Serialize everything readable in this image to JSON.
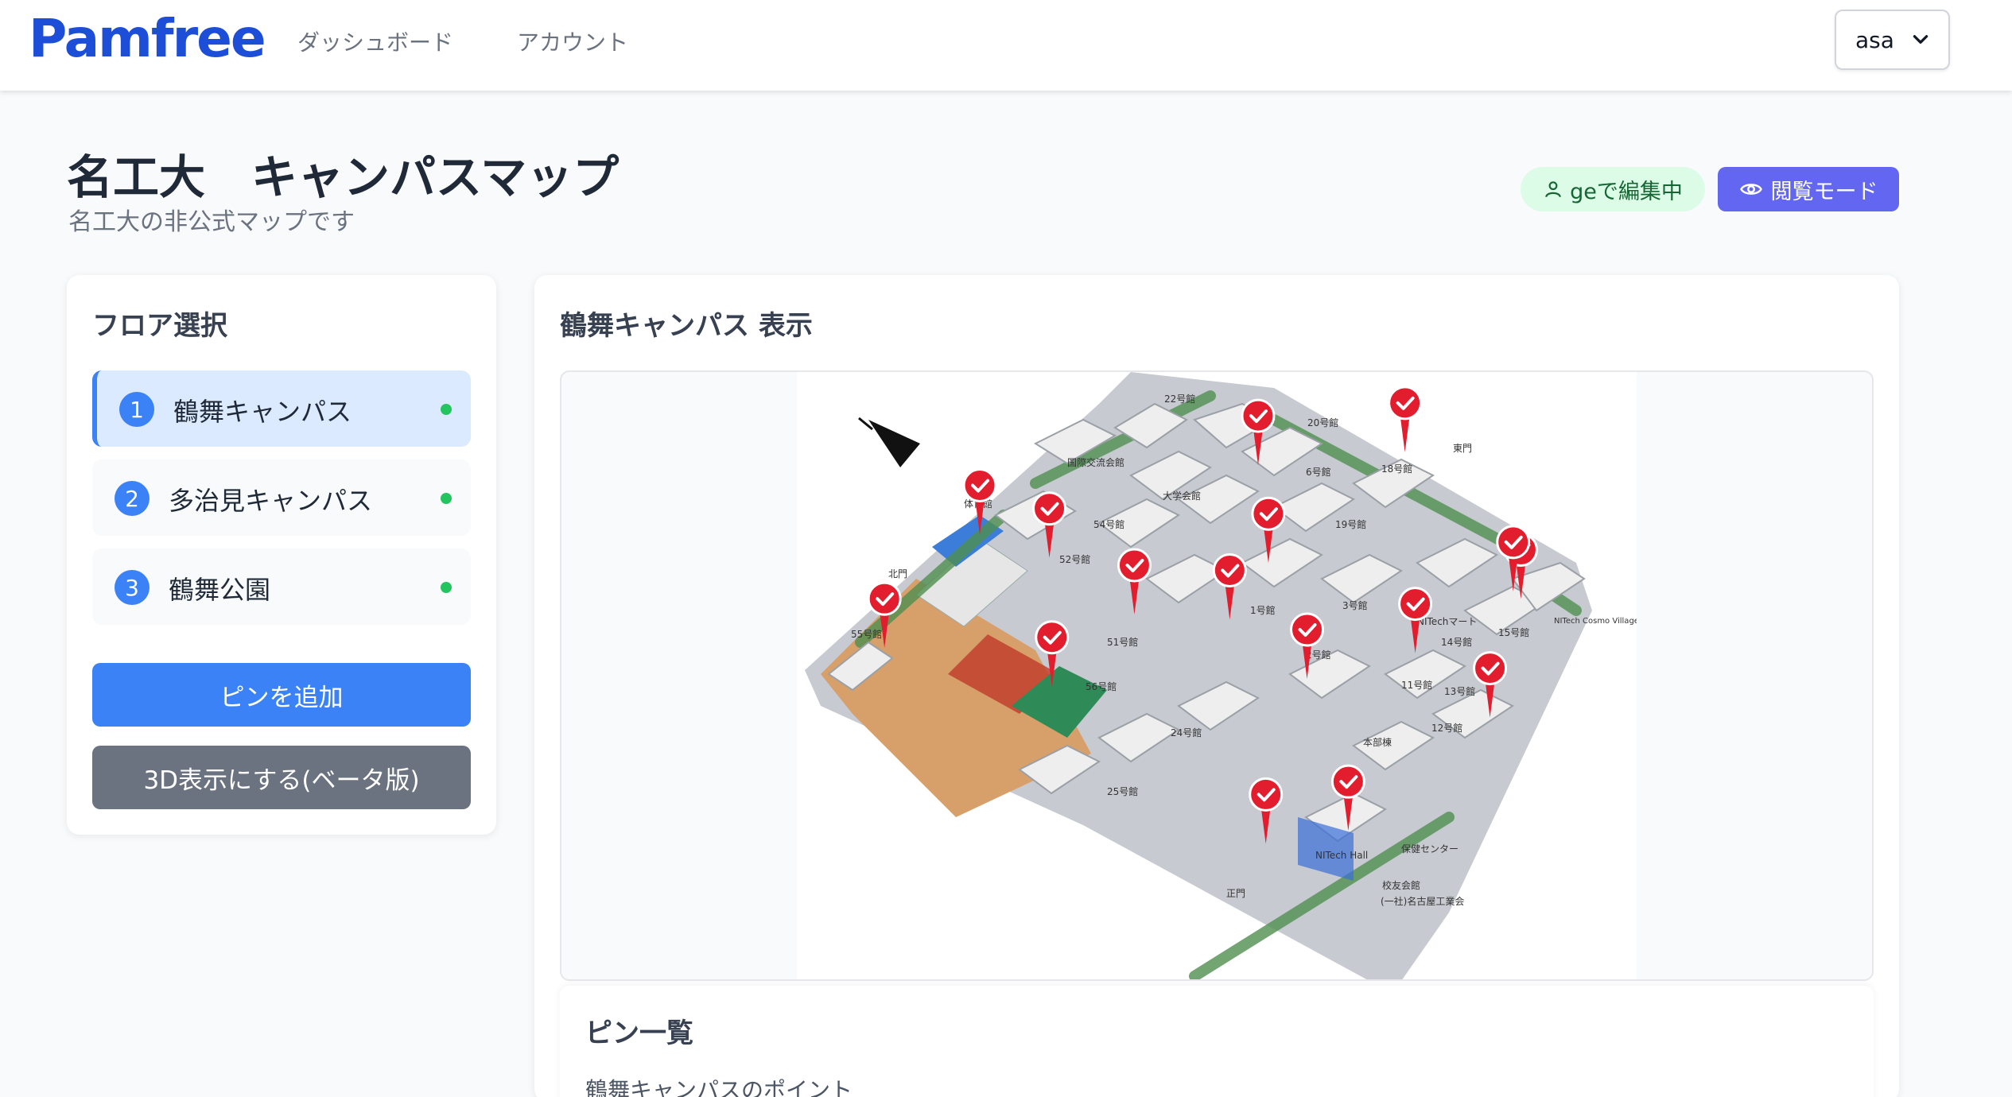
{
  "app": {
    "logo": "Pamfree"
  },
  "nav": {
    "dashboard": "ダッシュボード",
    "account": "アカウント"
  },
  "user": {
    "name": "asa"
  },
  "page": {
    "title": "名工大　キャンパスマップ",
    "subtitle": "名工大の非公式マップです"
  },
  "badges": {
    "editing": "geで編集中",
    "view_mode": "閲覧モード"
  },
  "floors": {
    "title": "フロア選択",
    "items": [
      {
        "num": "1",
        "label": "鶴舞キャンパス",
        "active": true
      },
      {
        "num": "2",
        "label": "多治見キャンパス",
        "active": false
      },
      {
        "num": "3",
        "label": "鶴舞公園",
        "active": false
      }
    ],
    "add_pin": "ピンを追加",
    "view_3d": "3D表示にする(ベータ版)"
  },
  "map": {
    "title": "鶴舞キャンパス 表示",
    "labels": {
      "b22": "22号館",
      "b20": "20号館",
      "kokusai": "国際交流会館",
      "taigaku": "大学会館",
      "b6": "6号館",
      "b18": "18号館",
      "b54": "54号館",
      "b19": "19号館",
      "b52": "52号館",
      "b1": "1号館",
      "b3": "3号館",
      "nitech_mart": "NITechマート",
      "b55": "55号館",
      "b51": "51号館",
      "b2": "2号館",
      "b14": "14号館",
      "b15": "15号館",
      "b56": "56号館",
      "b11": "11号館",
      "b13": "13号館",
      "b24": "24号館",
      "b12": "12号館",
      "honbu": "本部棟",
      "b25": "25号館",
      "nitech_hall": "NITech Hall",
      "hoken": "保健センター",
      "koyu": "校友会館",
      "meikoudai": "(一社)名古屋工業会",
      "seimon": "正門",
      "kitamon": "北門",
      "higashimon": "東門",
      "tai": "体育館",
      "cosmo": "NITech Cosmo Village"
    },
    "pin_count": 16
  },
  "pins_panel": {
    "title": "ピン一覧",
    "subtitle": "鶴舞キャンパスのポイント"
  }
}
